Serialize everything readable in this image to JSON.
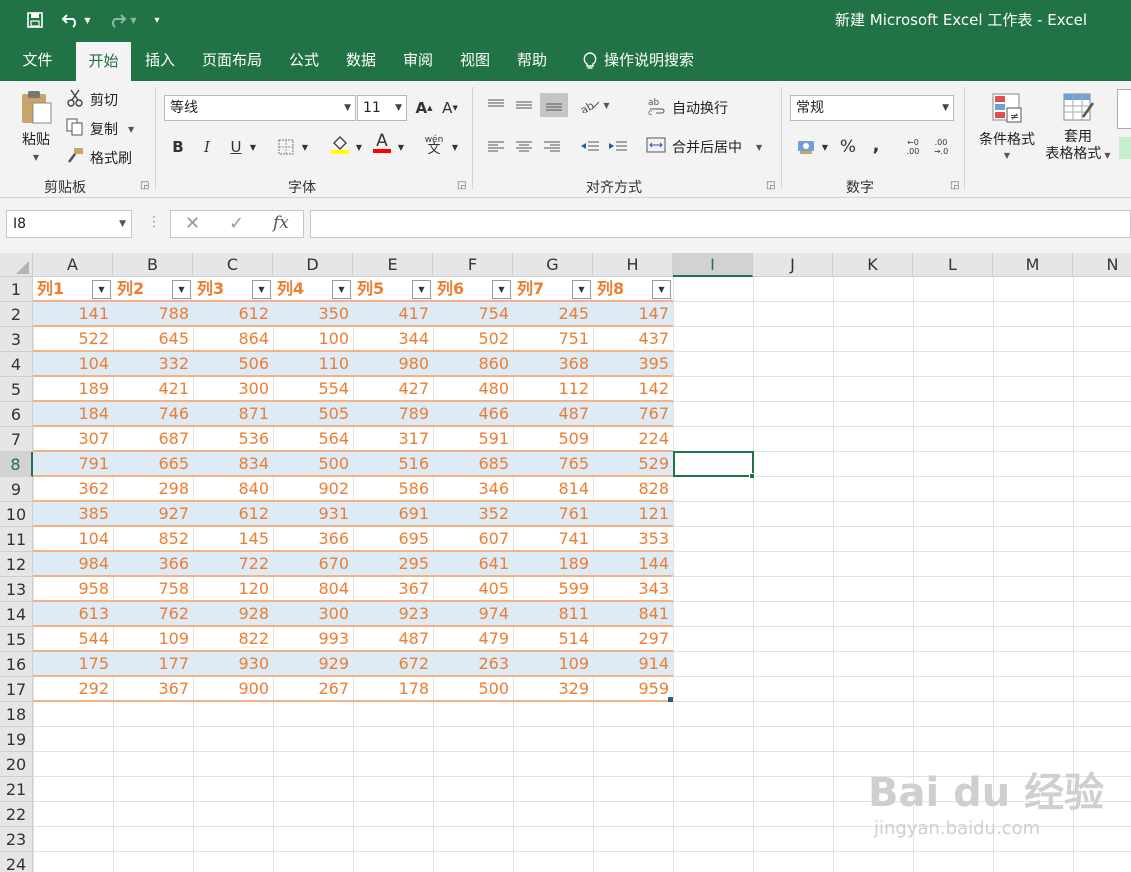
{
  "window": {
    "title": "新建 Microsoft Excel 工作表  -  Excel"
  },
  "menu": {
    "tabs": [
      "文件",
      "开始",
      "插入",
      "页面布局",
      "公式",
      "数据",
      "审阅",
      "视图",
      "帮助"
    ],
    "active": "开始",
    "tell_me": "操作说明搜索"
  },
  "ribbon": {
    "clipboard": {
      "paste": "粘贴",
      "cut": "剪切",
      "copy": "复制",
      "format_painter": "格式刷",
      "label": "剪贴板"
    },
    "font": {
      "name": "等线",
      "size": "11",
      "label": "字体",
      "bold": "B",
      "italic": "I",
      "underline": "U",
      "phonetic": "wén"
    },
    "alignment": {
      "wrap_text": "自动换行",
      "merge_center": "合并后居中",
      "label": "对齐方式"
    },
    "number": {
      "format": "常规",
      "percent": "%",
      "comma": ",",
      "label": "数字"
    },
    "styles": {
      "conditional_format": "条件格式",
      "table_format_line1": "套用",
      "table_format_line2": "表格格式"
    }
  },
  "formula_bar": {
    "name_box": "I8",
    "cancel": "✕",
    "enter": "✓",
    "fx": "fx",
    "formula": ""
  },
  "sheet": {
    "columns": [
      "A",
      "B",
      "C",
      "D",
      "E",
      "F",
      "G",
      "H",
      "I",
      "J",
      "K",
      "L",
      "M",
      "N"
    ],
    "rows": [
      "1",
      "2",
      "3",
      "4",
      "5",
      "6",
      "7",
      "8",
      "9",
      "10",
      "11",
      "12",
      "13",
      "14",
      "15",
      "16",
      "17",
      "18",
      "19",
      "20",
      "21",
      "22",
      "23",
      "24"
    ],
    "selected_column": "I",
    "selected_row": "8",
    "table_headers": [
      "列1",
      "列2",
      "列3",
      "列4",
      "列5",
      "列6",
      "列7",
      "列8"
    ],
    "table_rows": [
      [
        "141",
        "788",
        "612",
        "350",
        "417",
        "754",
        "245",
        "147"
      ],
      [
        "522",
        "645",
        "864",
        "100",
        "344",
        "502",
        "751",
        "437"
      ],
      [
        "104",
        "332",
        "506",
        "110",
        "980",
        "860",
        "368",
        "395"
      ],
      [
        "189",
        "421",
        "300",
        "554",
        "427",
        "480",
        "112",
        "142"
      ],
      [
        "184",
        "746",
        "871",
        "505",
        "789",
        "466",
        "487",
        "767"
      ],
      [
        "307",
        "687",
        "536",
        "564",
        "317",
        "591",
        "509",
        "224"
      ],
      [
        "791",
        "665",
        "834",
        "500",
        "516",
        "685",
        "765",
        "529"
      ],
      [
        "362",
        "298",
        "840",
        "902",
        "586",
        "346",
        "814",
        "828"
      ],
      [
        "385",
        "927",
        "612",
        "931",
        "691",
        "352",
        "761",
        "121"
      ],
      [
        "104",
        "852",
        "145",
        "366",
        "695",
        "607",
        "741",
        "353"
      ],
      [
        "984",
        "366",
        "722",
        "670",
        "295",
        "641",
        "189",
        "144"
      ],
      [
        "958",
        "758",
        "120",
        "804",
        "367",
        "405",
        "599",
        "343"
      ],
      [
        "613",
        "762",
        "928",
        "300",
        "923",
        "974",
        "811",
        "841"
      ],
      [
        "544",
        "109",
        "822",
        "993",
        "487",
        "479",
        "514",
        "297"
      ],
      [
        "175",
        "177",
        "930",
        "929",
        "672",
        "263",
        "109",
        "914"
      ],
      [
        "292",
        "367",
        "900",
        "267",
        "178",
        "500",
        "329",
        "959"
      ]
    ]
  },
  "colors": {
    "excel_green": "#217346",
    "table_text": "#ed7d31",
    "band": "#ddebf7"
  },
  "watermark": {
    "brand": "Bai du 经验",
    "url": "jingyan.baidu.com"
  }
}
